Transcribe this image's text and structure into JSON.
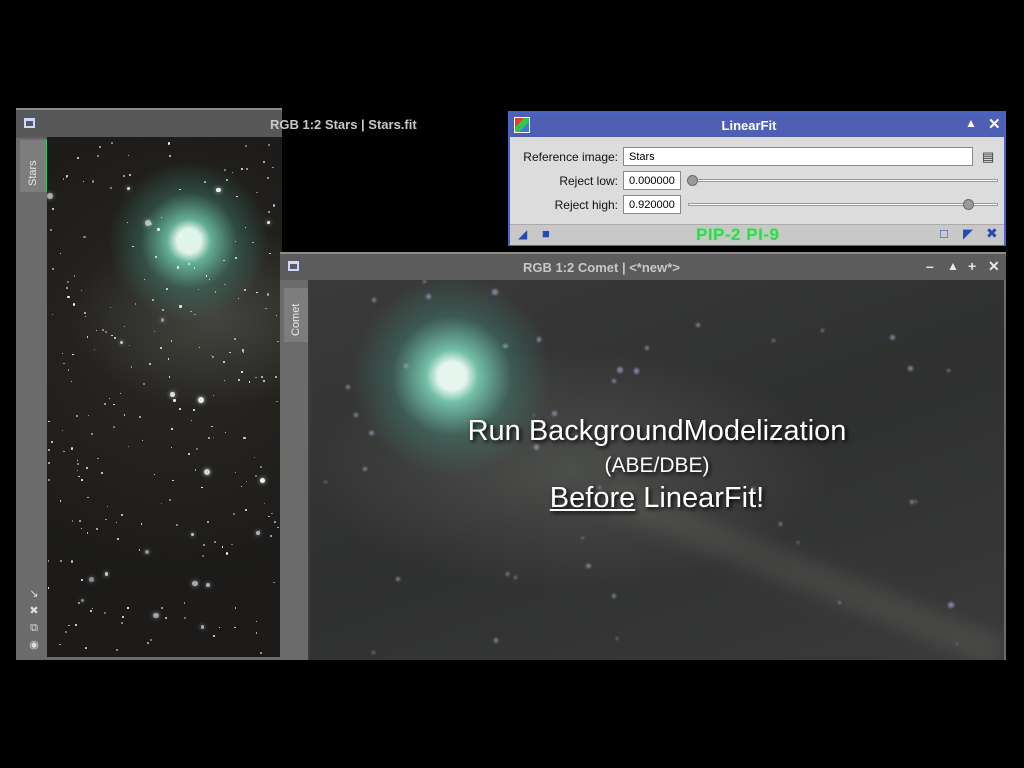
{
  "stars_window": {
    "title": "RGB 1:2 Stars | Stars.fit",
    "tab_label": "Stars",
    "side_icons": [
      "arrow-icon",
      "cross-icon",
      "copy-icon",
      "target-icon"
    ]
  },
  "linearfit": {
    "title": "LinearFit",
    "reference_label": "Reference image:",
    "reference_value": "Stars",
    "reject_low_label": "Reject low:",
    "reject_low_value": "0.000000",
    "reject_high_label": "Reject high:",
    "reject_high_value": "0.920000",
    "watermark": "PIP-2 PI-9",
    "accent_color": "#4e5fb4",
    "reject_low_slider_fraction": 0.0,
    "reject_high_slider_fraction": 0.92
  },
  "comet_window": {
    "title": "RGB 1:2 Comet | <*new*>",
    "tab_label": "Comet",
    "overlay_line1": "Run BackgroundModelization",
    "overlay_line2": "(ABE/DBE)",
    "overlay_before": "Before",
    "overlay_after": " LinearFit!"
  }
}
